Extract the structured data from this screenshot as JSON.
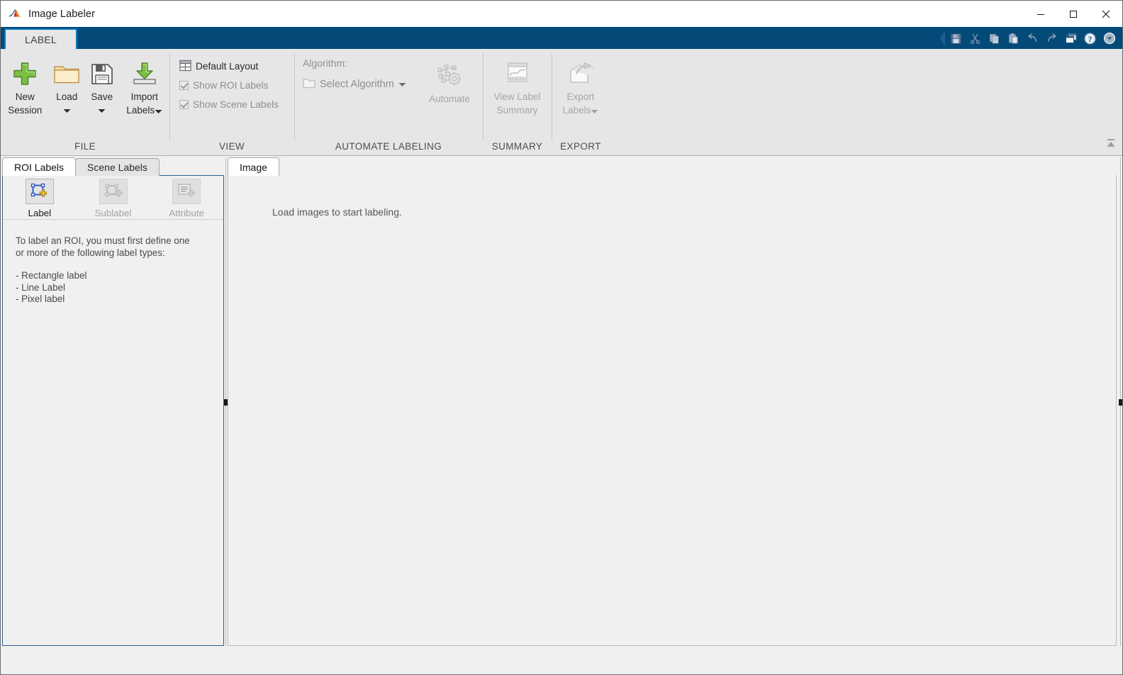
{
  "window": {
    "title": "Image Labeler",
    "app_icon": "matlab-logo-icon",
    "minimize_label": "—",
    "maximize_label": "□",
    "close_label": "✕"
  },
  "ribbon": {
    "tabs": [
      {
        "label": "LABEL",
        "active": true
      }
    ],
    "quick_access": [
      {
        "name": "save-icon",
        "enabled": false
      },
      {
        "name": "cut-icon",
        "enabled": false
      },
      {
        "name": "copy-icon",
        "enabled": false
      },
      {
        "name": "paste-icon",
        "enabled": false
      },
      {
        "name": "undo-icon",
        "enabled": false
      },
      {
        "name": "redo-icon",
        "enabled": false
      },
      {
        "name": "layout-icon",
        "enabled": true
      },
      {
        "name": "help-icon",
        "enabled": true
      },
      {
        "name": "customize-dropdown-icon",
        "enabled": true
      }
    ],
    "groups": [
      {
        "id": "file",
        "label": "FILE",
        "buttons": [
          {
            "label_line1": "New",
            "label_line2": "Session",
            "icon": "plus-icon",
            "enabled": true,
            "dropdown": false
          },
          {
            "label_line1": "Load",
            "label_line2": "",
            "icon": "folder-icon",
            "enabled": true,
            "dropdown": true
          },
          {
            "label_line1": "Save",
            "label_line2": "",
            "icon": "floppy-disk-icon",
            "enabled": true,
            "dropdown": true
          },
          {
            "label_line1": "Import",
            "label_line2": "Labels",
            "icon": "import-arrow-icon",
            "enabled": true,
            "dropdown": true
          }
        ]
      },
      {
        "id": "view",
        "label": "VIEW",
        "items": [
          {
            "label": "Default Layout",
            "icon": "grid-layout-icon",
            "type": "button",
            "enabled": true
          },
          {
            "label": "Show ROI Labels",
            "type": "checkbox",
            "checked": true,
            "enabled": false
          },
          {
            "label": "Show Scene Labels",
            "type": "checkbox",
            "checked": true,
            "enabled": false
          }
        ]
      },
      {
        "id": "automate",
        "label": "AUTOMATE LABELING",
        "algorithm_caption": "Algorithm:",
        "select_algorithm_label": "Select Algorithm",
        "select_algorithm_icon": "folder-outline-icon",
        "automate": {
          "label": "Automate",
          "icon": "automate-network-icon",
          "enabled": false
        }
      },
      {
        "id": "summary",
        "label": "SUMMARY",
        "button": {
          "label_line1": "View Label",
          "label_line2": "Summary",
          "icon": "label-summary-icon",
          "enabled": false
        }
      },
      {
        "id": "export",
        "label": "EXPORT",
        "button": {
          "label_line1": "Export",
          "label_line2": "Labels",
          "icon": "export-arrow-icon",
          "enabled": false,
          "dropdown": true
        }
      }
    ],
    "collapse_icon": "collapse-ribbon-icon"
  },
  "left_panel": {
    "tabs": [
      {
        "label": "ROI Labels",
        "active": true
      },
      {
        "label": "Scene Labels",
        "active": false
      }
    ],
    "actions": [
      {
        "label": "Label",
        "icon": "roi-label-icon",
        "enabled": true
      },
      {
        "label": "Sublabel",
        "icon": "sublabel-icon",
        "enabled": false
      },
      {
        "label": "Attribute",
        "icon": "attribute-icon",
        "enabled": false
      }
    ],
    "hint": {
      "line1": "To label an ROI, you must first define one",
      "line2": "or more of the following label types:",
      "bullet1": "- Rectangle label",
      "bullet2": "- Line Label",
      "bullet3": "- Pixel label"
    }
  },
  "right_panel": {
    "tabs": [
      {
        "label": "Image",
        "active": true
      }
    ],
    "placeholder_message": "Load images to start labeling."
  },
  "colors": {
    "ribbon_tabstrip": "#034a79",
    "tab_accent": "#0c76bc",
    "ribbon_bg": "#e6e6e6",
    "panel_border": "#2f5f8f",
    "app_bg": "#f0f0f0",
    "text": "#2b2b2b",
    "disabled_text": "#a2a2a2"
  }
}
